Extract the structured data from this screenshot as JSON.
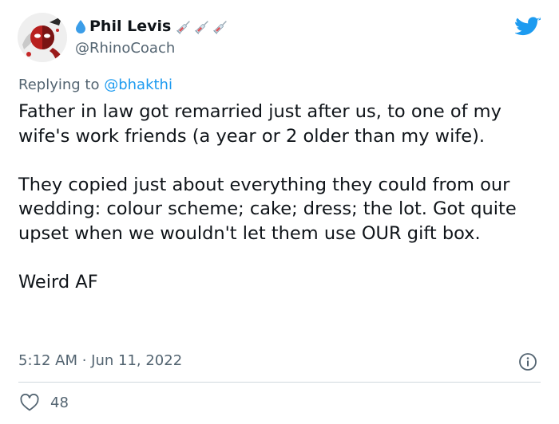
{
  "author": {
    "name": "Phil Levis",
    "handle": "@RhinoCoach",
    "name_prefix_icon": "water-drop-icon",
    "name_suffix_icons": [
      "syringe-icon",
      "syringe-icon",
      "syringe-icon"
    ],
    "avatar_icon": "avatar-image"
  },
  "reply": {
    "prefix": "Replying to ",
    "target": "@bhakthi"
  },
  "tweet": {
    "paragraphs": [
      "Father in law got remarried just after us, to one of my wife's work friends (a year or 2 older than my wife).",
      "They copied just about everything they could from our wedding: colour scheme; cake; dress; the lot. Got quite upset when we wouldn't let them use OUR gift box.",
      "Weird AF"
    ],
    "timestamp": "5:12 AM · Jun 11, 2022",
    "likes": "48"
  },
  "icons": {
    "brand": "twitter-bird-icon",
    "info": "info-icon",
    "like": "heart-icon"
  },
  "colors": {
    "brand_blue": "#1d9bf0",
    "secondary_text": "#536471",
    "primary_text": "#0f1419",
    "divider": "#cfd9de"
  }
}
